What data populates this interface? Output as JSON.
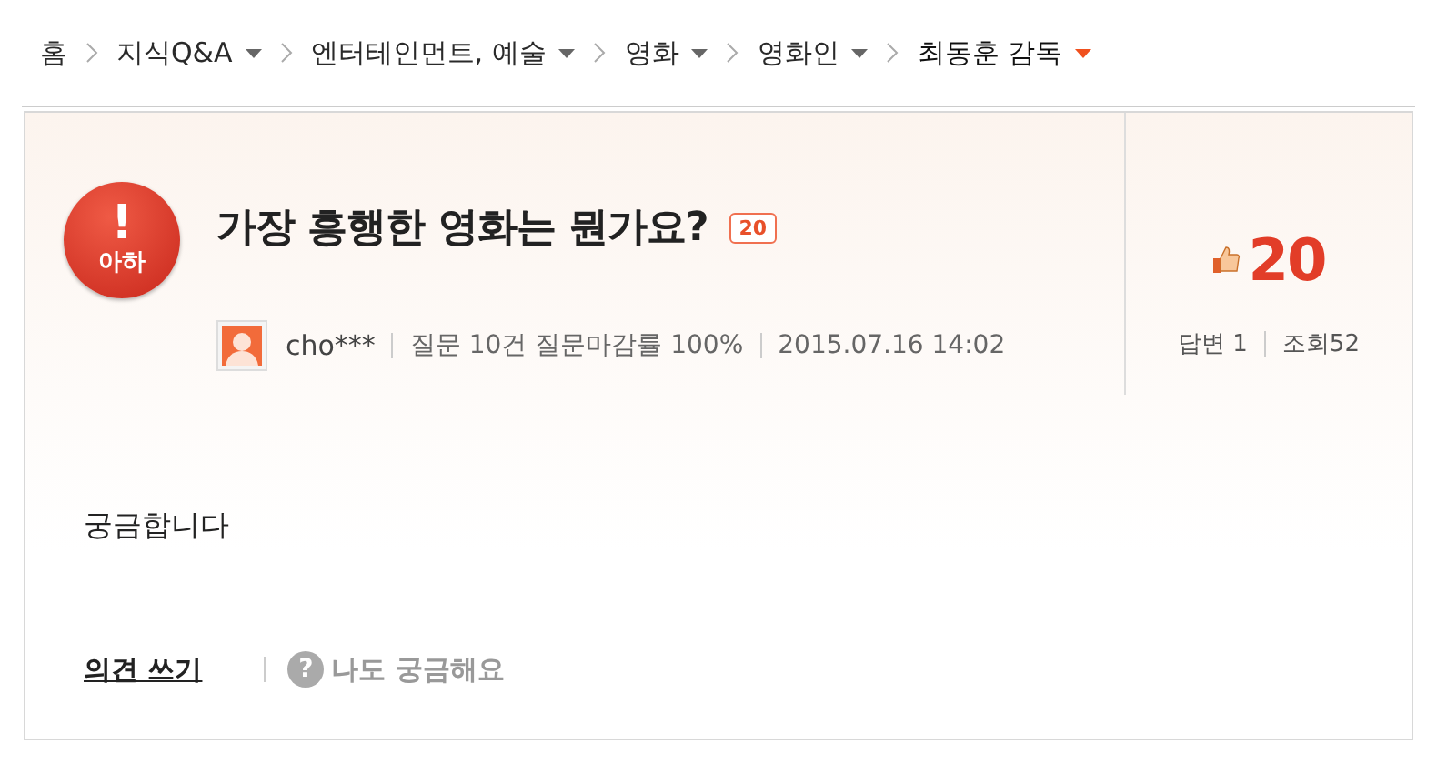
{
  "breadcrumb": [
    {
      "label": "홈",
      "dropdown": false,
      "selected": false
    },
    {
      "label": "지식Q&A",
      "dropdown": true,
      "selected": false
    },
    {
      "label": "엔터테인먼트, 예술",
      "dropdown": true,
      "selected": false
    },
    {
      "label": "영화",
      "dropdown": true,
      "selected": false
    },
    {
      "label": "영화인",
      "dropdown": true,
      "selected": false
    },
    {
      "label": "최동훈 감독",
      "dropdown": true,
      "selected": true
    }
  ],
  "question": {
    "badge": "아하",
    "badge_mark": "!",
    "title": "가장 흥행한 영화는 뭔가요?",
    "reward": "20",
    "author": "cho***",
    "stats": "질문 10건 질문마감률 100%",
    "date": "2015.07.16 14:02",
    "likes": "20",
    "answers": "답변 1",
    "views": "조회52",
    "body": "궁금합니다"
  },
  "actions": {
    "comment": "의견 쓰기",
    "help_mark": "?",
    "curious": "나도 궁금해요"
  }
}
